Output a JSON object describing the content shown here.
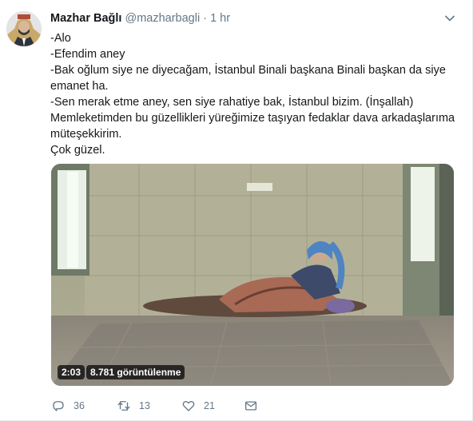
{
  "tweet": {
    "author_name": "Mazhar Bağlı",
    "handle": "@mazharbagli",
    "separator": "·",
    "time": "1 hr",
    "lines": [
      "-Alo",
      "-Efendim aney",
      "-Bak oğlum siye ne diyecağam, İstanbul Binali başkana Binali başkan da siye",
      "emanet ha.",
      "-Sen merak etme aney, sen siye rahatiye bak, İstanbul bizim. (İnşallah)",
      "Memleketimden bu güzellikleri yüreğimize taşıyan fedaklar dava arkadaşlarıma",
      "müteşekkirim.",
      "Çok güzel."
    ]
  },
  "video": {
    "duration": "2:03",
    "views": "8.781 görüntülenme"
  },
  "actions": {
    "replies": "36",
    "retweets": "13",
    "likes": "21"
  },
  "icons": {
    "menu": "chevron-down-icon",
    "reply": "reply-icon",
    "retweet": "retweet-icon",
    "like": "heart-icon",
    "dm": "envelope-icon"
  }
}
